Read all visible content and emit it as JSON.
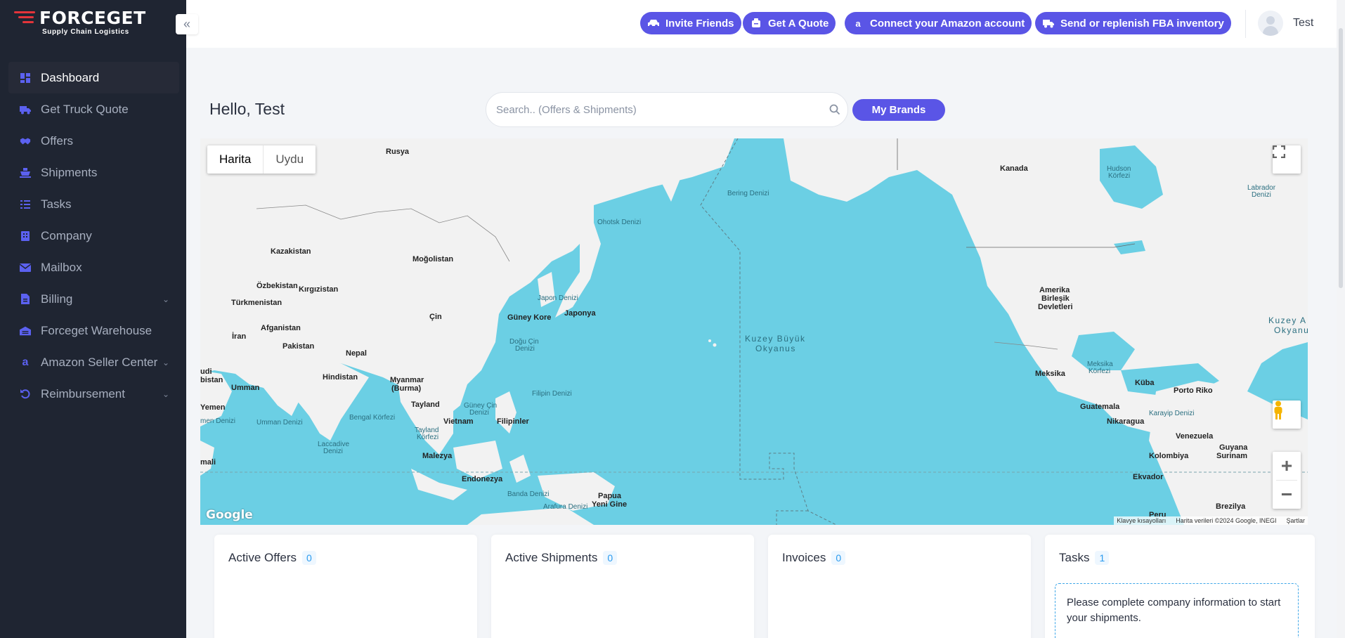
{
  "brand": {
    "name": "FORCEGET",
    "tagline": "Supply Chain Logistics",
    "accent_color": "#5a55e6",
    "logo_color": "#e3343a"
  },
  "sidebar": {
    "collapse_icon": "double-chevron-left-icon",
    "items": [
      {
        "label": "Dashboard",
        "icon": "dashboard-icon",
        "active": true,
        "has_submenu": false
      },
      {
        "label": "Get Truck Quote",
        "icon": "truck-icon",
        "active": false,
        "has_submenu": false
      },
      {
        "label": "Offers",
        "icon": "handshake-icon",
        "active": false,
        "has_submenu": false
      },
      {
        "label": "Shipments",
        "icon": "ship-icon",
        "active": false,
        "has_submenu": false
      },
      {
        "label": "Tasks",
        "icon": "checklist-icon",
        "active": false,
        "has_submenu": false
      },
      {
        "label": "Company",
        "icon": "building-icon",
        "active": false,
        "has_submenu": false
      },
      {
        "label": "Mailbox",
        "icon": "envelope-icon",
        "active": false,
        "has_submenu": false
      },
      {
        "label": "Billing",
        "icon": "invoice-icon",
        "active": false,
        "has_submenu": true
      },
      {
        "label": "Forceget Warehouse",
        "icon": "warehouse-icon",
        "active": false,
        "has_submenu": false
      },
      {
        "label": "Amazon Seller Center",
        "icon": "amazon-icon",
        "active": false,
        "has_submenu": true
      },
      {
        "label": "Reimbursement",
        "icon": "undo-icon",
        "active": false,
        "has_submenu": true
      }
    ]
  },
  "topbar": {
    "buttons": [
      {
        "label": "Invite Friends",
        "icon": "car-icon"
      },
      {
        "label": "Get A Quote",
        "icon": "quote-icon"
      },
      {
        "label": "Connect your Amazon account",
        "icon": "amazon-icon"
      },
      {
        "label": "Send or replenish FBA inventory",
        "icon": "truck-icon"
      }
    ],
    "user_name": "Test"
  },
  "main": {
    "greeting": "Hello, Test",
    "search_placeholder": "Search.. (Offers & Shipments)",
    "my_brands_label": "My Brands"
  },
  "map": {
    "toggle_map": "Harita",
    "toggle_satellite": "Uydu",
    "active_toggle": "Harita",
    "google_label": "Google",
    "attrib_shortcuts": "Klavye kısayolları",
    "attrib_data": "Harita verileri ©2024 Google, INEGI",
    "attrib_terms": "Şartlar",
    "labels": {
      "rusya": "Rusya",
      "kazakistan": "Kazakistan",
      "mogolistan": "Moğolistan",
      "ozbekistan": "Özbekistan",
      "kirgizistan": "Kırgızistan",
      "turkmenistan": "Türkmenistan",
      "afganistan": "Afganistan",
      "iran": "İran",
      "pakistan": "Pakistan",
      "nepal": "Nepal",
      "hindistan": "Hindistan",
      "cin": "Çin",
      "guney_kore": "Güney Kore",
      "japonya": "Japonya",
      "japon_denizi": "Japon Denizi",
      "ohotsk": "Ohotsk Denizi",
      "bering": "Bering Denizi",
      "dogu_cin_1": "Doğu Çin",
      "dogu_cin_2": "Denizi",
      "myanmar_1": "Myanmar",
      "myanmar_2": "(Burma)",
      "tayland": "Tayland",
      "vietnam": "Vietnam",
      "filipinler": "Filipinler",
      "filipin_denizi": "Filipin Denizi",
      "guney_cin_1": "Güney Çin",
      "guney_cin_2": "Denizi",
      "tayland_korfezi_1": "Tayland",
      "tayland_korfezi_2": "Körfezi",
      "malezya": "Malezya",
      "endonezya": "Endonezya",
      "banda": "Banda Denizi",
      "arafura": "Arafura Denizi",
      "papua_1": "Papua",
      "papua_2": "Yeni Gine",
      "bengal": "Bengal Körfezi",
      "umman_denizi": "Umman Denizi",
      "umman": "Umman",
      "lakkadiv_1": "Laccadive",
      "lakkadiv_2": "Denizi",
      "suudi_1": "udi",
      "suudi_2": "bistan",
      "yemen": "Yemen",
      "yemen_denizi": "men Denizi",
      "somali": "mali",
      "kuzey_buyuk_1": "Kuzey Büyük",
      "kuzey_buyuk_2": "Okyanus",
      "kanada": "Kanada",
      "hudson_1": "Hudson",
      "hudson_2": "Körfezi",
      "labrador_1": "Labrador",
      "labrador_2": "Denizi",
      "abd_1": "Amerika",
      "abd_2": "Birleşik",
      "abd_3": "Devletleri",
      "meksika": "Meksika",
      "meksika_korfezi_1": "Meksika",
      "meksika_korfezi_2": "Körfezi",
      "kuba": "Küba",
      "porto_riko": "Porto Riko",
      "guatemala": "Guatemala",
      "nikaragua": "Nikaragua",
      "karayip": "Karayip Denizi",
      "venezuela": "Venezuela",
      "guyana": "Guyana",
      "surinam": "Surinam",
      "kolombiya": "Kolombiya",
      "ekvador": "Ekvador",
      "peru": "Peru",
      "brezilya": "Brezilya",
      "kuzey_atl_1": "Kuzey A",
      "kuzey_atl_2": "Okyanu"
    }
  },
  "cards": [
    {
      "title": "Active Offers",
      "count": "0"
    },
    {
      "title": "Active Shipments",
      "count": "0"
    },
    {
      "title": "Invoices",
      "count": "0"
    },
    {
      "title": "Tasks",
      "count": "1",
      "message": "Please complete company information to start your shipments."
    }
  ]
}
